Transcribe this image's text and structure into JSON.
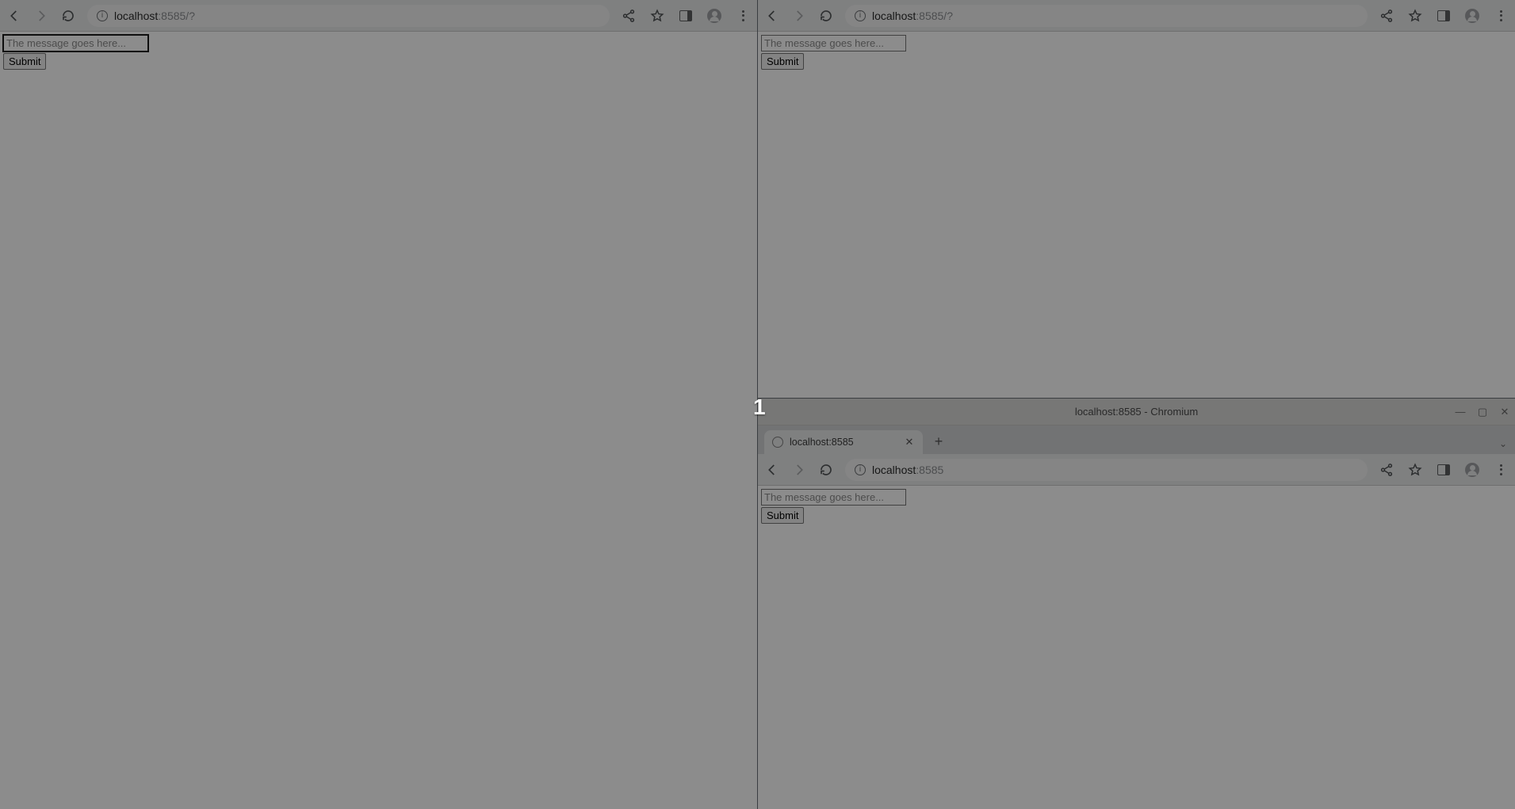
{
  "workspace_number": "1",
  "url": {
    "host": "localhost",
    "port_path": ":8585/?",
    "port_only": ":8585",
    "full_display": "localhost:8585"
  },
  "form": {
    "placeholder": "The message goes here...",
    "submit_label": "Submit"
  },
  "windows": {
    "left": {
      "has_titlebar": false,
      "has_tabstrip": false,
      "input_focused": true
    },
    "top_right": {
      "has_titlebar": false,
      "has_tabstrip": false,
      "input_focused": false
    },
    "bottom_right": {
      "title": "localhost:8585 - Chromium",
      "tab_label": "localhost:8585",
      "has_titlebar": true,
      "has_tabstrip": true,
      "input_focused": false
    }
  }
}
